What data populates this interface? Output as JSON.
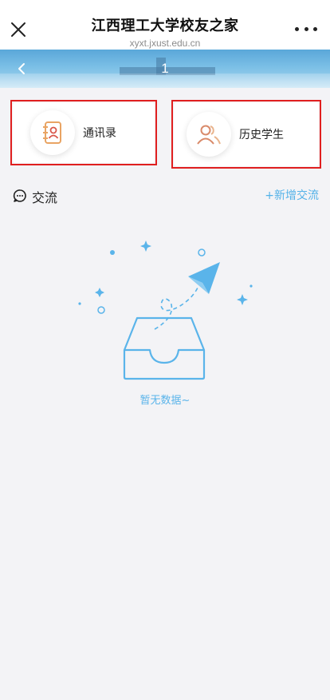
{
  "header": {
    "title": "江西理工大学校友之家",
    "subtitle": "xyxt.jxust.edu.cn"
  },
  "banner": {
    "number": "1"
  },
  "cards": [
    {
      "label": "通讯录",
      "icon": "contacts-book-icon"
    },
    {
      "label": "历史学生",
      "icon": "people-icon"
    }
  ],
  "section": {
    "title": "交流",
    "add_label": "+新增交流",
    "icon": "chat-bubble-icon"
  },
  "empty": {
    "text": "暂无数据~"
  },
  "colors": {
    "accent": "#54b2e8",
    "highlight_border": "#e01f1f",
    "background": "#f3f3f6"
  }
}
